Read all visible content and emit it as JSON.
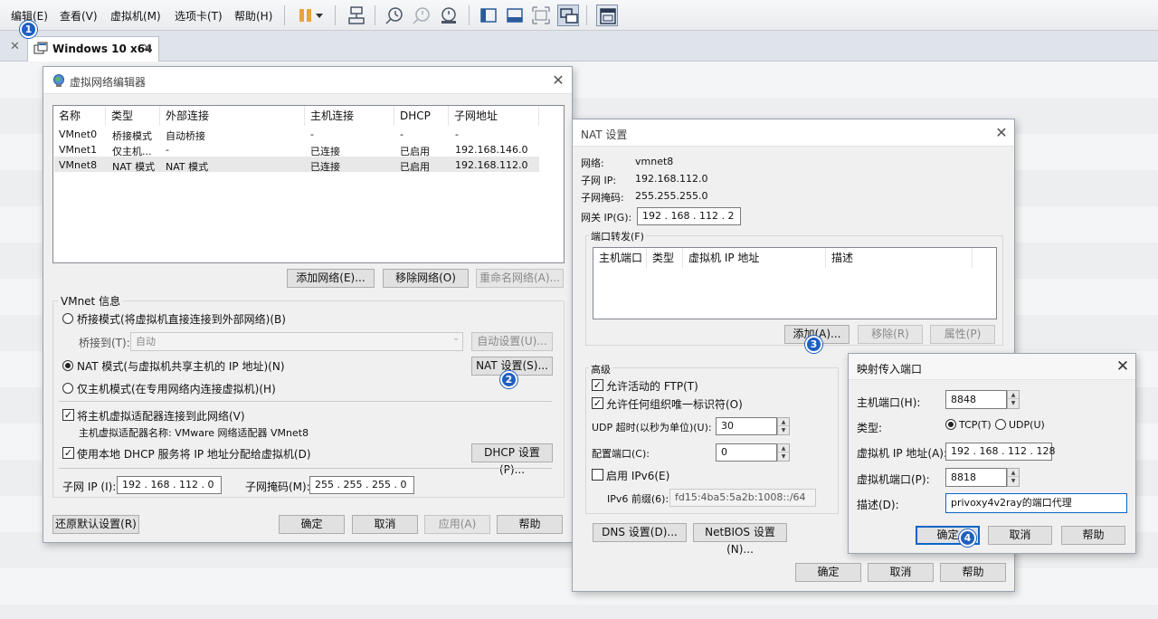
{
  "menubar": {
    "items": [
      "编辑(E)",
      "查看(V)",
      "虚拟机(M)",
      "选项卡(T)",
      "帮助(H)"
    ]
  },
  "tabbar": {
    "vm_tab_label": "Windows 10 x64"
  },
  "badges": [
    "1",
    "2",
    "3",
    "4"
  ],
  "vne": {
    "title": "虚拟网络编辑器",
    "columns": [
      "名称",
      "类型",
      "外部连接",
      "主机连接",
      "DHCP",
      "子网地址"
    ],
    "rows": [
      [
        "VMnet0",
        "桥接模式",
        "自动桥接",
        "-",
        "-",
        "-"
      ],
      [
        "VMnet1",
        "仅主机...",
        "-",
        "已连接",
        "已启用",
        "192.168.146.0"
      ],
      [
        "VMnet8",
        "NAT 模式",
        "NAT 模式",
        "已连接",
        "已启用",
        "192.168.112.0"
      ]
    ],
    "add_network": "添加网络(E)...",
    "remove_network": "移除网络(O)",
    "rename_network": "重命名网络(A)...",
    "vmnet_info": "VMnet 信息",
    "bridge_mode": "桥接模式(将虚拟机直接连接到外部网络)(B)",
    "bridge_to": "桥接到(T):",
    "bridge_value": "自动",
    "auto_settings": "自动设置(U)...",
    "nat_mode": "NAT 模式(与虚拟机共享主机的 IP 地址)(N)",
    "nat_settings": "NAT 设置(S)...",
    "host_only": "仅主机模式(在专用网络内连接虚拟机)(H)",
    "connect_adapter": "将主机虚拟适配器连接到此网络(V)",
    "adapter_name": "主机虚拟适配器名称: VMware 网络适配器 VMnet8",
    "use_dhcp": "使用本地 DHCP 服务将 IP 地址分配给虚拟机(D)",
    "dhcp_settings": "DHCP 设置(P)...",
    "subnet_ip_label": "子网 IP (I):",
    "subnet_ip": "192 . 168 . 112 .  0",
    "mask_label": "子网掩码(M):",
    "mask": "255 . 255 . 255 .  0",
    "restore_defaults": "还原默认设置(R)",
    "ok": "确定",
    "cancel": "取消",
    "apply": "应用(A)",
    "help": "帮助"
  },
  "nat": {
    "title": "NAT 设置",
    "network_label": "网络:",
    "network": "vmnet8",
    "subnet_ip_label": "子网 IP:",
    "subnet_ip": "192.168.112.0",
    "mask_label": "子网掩码:",
    "mask": "255.255.255.0",
    "gateway_label": "网关 IP(G):",
    "gateway": "192 . 168 . 112 .  2",
    "port_forward": "端口转发(F)",
    "columns": [
      "主机端口",
      "类型",
      "虚拟机 IP 地址",
      "描述"
    ],
    "add": "添加(A)...",
    "remove": "移除(R)",
    "properties": "属性(P)",
    "advanced": "高级",
    "allow_ftp": "允许活动的 FTP(T)",
    "allow_oui": "允许任何组织唯一标识符(O)",
    "udp_timeout_label": "UDP 超时(以秒为单位)(U):",
    "udp_timeout": "30",
    "config_port_label": "配置端口(C):",
    "config_port": "0",
    "enable_ipv6": "启用 IPv6(E)",
    "ipv6_prefix_label": "IPv6 前缀(6):",
    "ipv6_prefix": "fd15:4ba5:5a2b:1008::/64",
    "dns_settings": "DNS 设置(D)...",
    "netbios_settings": "NetBIOS 设置(N)...",
    "ok": "确定",
    "cancel": "取消",
    "help": "帮助"
  },
  "map": {
    "title": "映射传入端口",
    "host_port_label": "主机端口(H):",
    "host_port": "8848",
    "type_label": "类型:",
    "tcp": "TCP(T)",
    "udp": "UDP(U)",
    "vm_ip_label": "虚拟机 IP 地址(A):",
    "vm_ip": "192 . 168 . 112 . 128",
    "vm_port_label": "虚拟机端口(P):",
    "vm_port": "8818",
    "desc_label": "描述(D):",
    "desc": "privoxy4v2ray的端口代理",
    "ok": "确定",
    "cancel": "取消",
    "help": "帮助"
  },
  "colors": {
    "accent": "#0a64c8",
    "badge": "#1f5fbf",
    "dialog_bg": "#f0f0f0",
    "pause": "#e8a33d"
  }
}
